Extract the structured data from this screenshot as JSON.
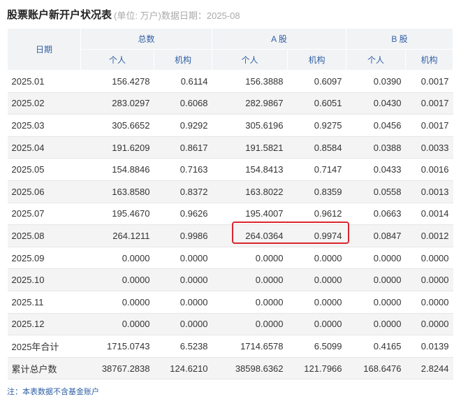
{
  "title": "股票账户新开户状况表",
  "subtitle": "(单位: 万户)数据日期：2025-08",
  "header": {
    "date": "日期",
    "total": "总数",
    "a": "A 股",
    "b": "B 股",
    "person": "个人",
    "inst": "机构"
  },
  "rows": [
    [
      "2025.01",
      "156.4278",
      "0.6114",
      "156.3888",
      "0.6097",
      "0.0390",
      "0.0017"
    ],
    [
      "2025.02",
      "283.0297",
      "0.6068",
      "282.9867",
      "0.6051",
      "0.0430",
      "0.0017"
    ],
    [
      "2025.03",
      "305.6652",
      "0.9292",
      "305.6196",
      "0.9275",
      "0.0456",
      "0.0017"
    ],
    [
      "2025.04",
      "191.6209",
      "0.8617",
      "191.5821",
      "0.8584",
      "0.0388",
      "0.0033"
    ],
    [
      "2025.05",
      "154.8846",
      "0.7163",
      "154.8413",
      "0.7147",
      "0.0433",
      "0.0016"
    ],
    [
      "2025.06",
      "163.8580",
      "0.8372",
      "163.8022",
      "0.8359",
      "0.0558",
      "0.0013"
    ],
    [
      "2025.07",
      "195.4670",
      "0.9626",
      "195.4007",
      "0.9612",
      "0.0663",
      "0.0014"
    ],
    [
      "2025.08",
      "264.1211",
      "0.9986",
      "264.0364",
      "0.9974",
      "0.0847",
      "0.0012"
    ],
    [
      "2025.09",
      "0.0000",
      "0.0000",
      "0.0000",
      "0.0000",
      "0.0000",
      "0.0000"
    ],
    [
      "2025.10",
      "0.0000",
      "0.0000",
      "0.0000",
      "0.0000",
      "0.0000",
      "0.0000"
    ],
    [
      "2025.11",
      "0.0000",
      "0.0000",
      "0.0000",
      "0.0000",
      "0.0000",
      "0.0000"
    ],
    [
      "2025.12",
      "0.0000",
      "0.0000",
      "0.0000",
      "0.0000",
      "0.0000",
      "0.0000"
    ],
    [
      "2025年合计",
      "1715.0743",
      "6.5238",
      "1714.6578",
      "6.5099",
      "0.4165",
      "0.0139"
    ],
    [
      "累计总户数",
      "38767.2838",
      "124.6210",
      "38598.6362",
      "121.7966",
      "168.6476",
      "2.8244"
    ]
  ],
  "note": "注：本表数据不含基金账户",
  "colors": {
    "header_text": "#2f5fa5",
    "highlight": "#d9262c"
  }
}
